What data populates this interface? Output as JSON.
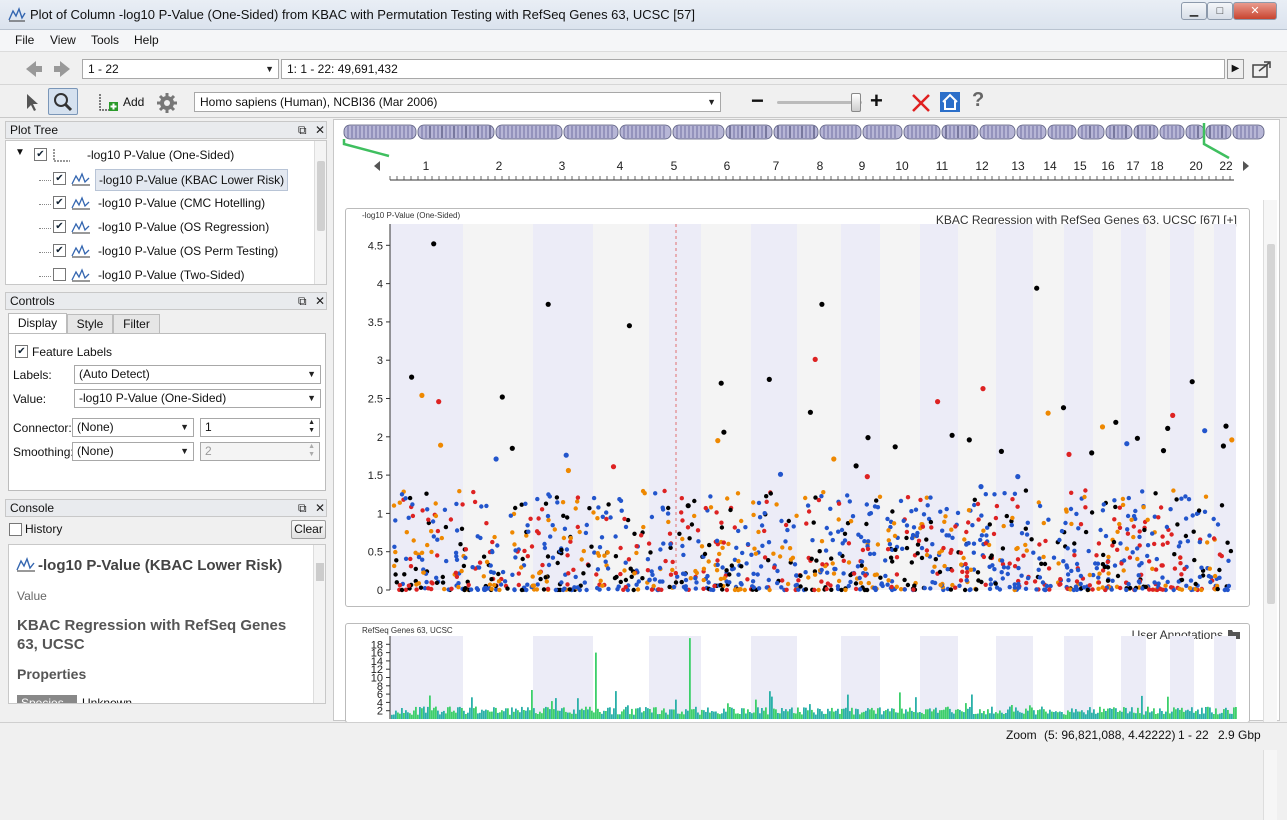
{
  "window": {
    "title": "Plot of Column -log10 P-Value (One-Sided) from KBAC with Permutation Testing with RefSeq Genes 63, UCSC [57]",
    "controls": {
      "minimize": "▁",
      "maximize": "□",
      "close": "✕"
    }
  },
  "menu": [
    "File",
    "View",
    "Tools",
    "Help"
  ],
  "nav": {
    "range": "1 - 22",
    "location": "1: 1 - 22: 49,691,432"
  },
  "toolbar": {
    "add_label": "Add",
    "genome": "Homo sapiens (Human), NCBI36 (Mar 2006)",
    "zoom_level": 0.95
  },
  "plot_tree": {
    "title": "Plot Tree",
    "items": [
      {
        "label": "-log10 P-Value (One-Sided)",
        "checked": true,
        "level": 0
      },
      {
        "label": "-log10 P-Value (KBAC Lower Risk)",
        "checked": true,
        "level": 1,
        "selected": true
      },
      {
        "label": "-log10 P-Value (CMC Hotelling)",
        "checked": true,
        "level": 1
      },
      {
        "label": "-log10 P-Value (OS Regression)",
        "checked": true,
        "level": 1
      },
      {
        "label": "-log10 P-Value (OS Perm Testing)",
        "checked": true,
        "level": 1
      },
      {
        "label": "-log10 P-Value (Two-Sided)",
        "checked": false,
        "level": 1
      }
    ]
  },
  "controls": {
    "title": "Controls",
    "tabs": [
      "Display",
      "Style",
      "Filter"
    ],
    "feature_labels": "Feature Labels",
    "labels_label": "Labels:",
    "labels_value": "(Auto Detect)",
    "value_label": "Value:",
    "value_value": "-log10 P-Value (One-Sided)",
    "connector_label": "Connector:",
    "connector_value": "(None)",
    "connector_num": "1",
    "smoothing_label": "Smoothing:",
    "smoothing_value": "(None)",
    "smoothing_num": "2"
  },
  "console": {
    "title": "Console",
    "history": "History",
    "clear": "Clear",
    "heading": "-log10 P-Value (KBAC Lower Risk)",
    "sub": "Value",
    "source": "KBAC Regression with RefSeq Genes 63, UCSC",
    "properties": "Properties",
    "prop_key": "Species",
    "prop_val": "Unknown"
  },
  "chromosomes": [
    "1",
    "2",
    "3",
    "4",
    "5",
    "6",
    "7",
    "8",
    "9",
    "10",
    "11",
    "12",
    "13",
    "14",
    "15",
    "16",
    "17",
    "18",
    "20",
    "22"
  ],
  "plot": {
    "ylabel": "-log10 P-Value (One-Sided)",
    "source_label": "KBAC Regression with RefSeq Genes 63, UCSC [67] [+]",
    "yticks": [
      "4.5",
      "4",
      "3.5",
      "3",
      "2.5",
      "2",
      "1.5",
      "1",
      "0.5",
      "0"
    ]
  },
  "annotations": {
    "ylabel": "RefSeq Genes 63, UCSC",
    "user_annotations": "User Annotations",
    "yticks": [
      "18",
      "16",
      "14",
      "12",
      "10",
      "8",
      "6",
      "4",
      "2"
    ]
  },
  "chart_data": {
    "type": "scatter",
    "title": "",
    "xlabel": "",
    "ylabel": "-log10 P-Value (One-Sided)",
    "ylim": [
      0,
      4.7
    ],
    "series": [
      {
        "color": "#000000",
        "x": [
          1,
          1,
          2,
          2,
          3,
          4,
          5,
          6,
          6,
          7,
          8,
          8,
          9,
          9,
          10,
          11,
          12,
          13,
          14,
          14,
          15,
          16,
          17,
          18,
          19,
          20,
          21,
          22
        ],
        "values": [
          2.78,
          4.52,
          2.52,
          1.85,
          3.73,
          3.45,
          1.1,
          2.06,
          2.7,
          2.75,
          3.73,
          2.32,
          1.62,
          1.99,
          1.87,
          2.02,
          1.96,
          1.81,
          3.94,
          2.38,
          1.79,
          2.19,
          1.98,
          1.82,
          2.11,
          2.72,
          2.14,
          1.88
        ]
      },
      {
        "color": "#ee8800",
        "x": [
          1,
          1,
          3,
          6,
          8,
          14,
          16,
          21
        ],
        "values": [
          2.54,
          1.89,
          1.56,
          1.95,
          1.71,
          2.31,
          2.13,
          1.96
        ]
      },
      {
        "color": "#dd2222",
        "x": [
          1,
          4,
          8,
          9,
          11,
          12,
          15,
          18
        ],
        "values": [
          2.46,
          1.61,
          3.01,
          1.48,
          2.46,
          2.63,
          1.77,
          2.28
        ]
      },
      {
        "color": "#2255cc",
        "x": [
          2,
          3,
          7,
          12,
          13,
          17,
          20
        ],
        "values": [
          1.71,
          1.76,
          1.51,
          1.35,
          1.48,
          1.91,
          2.08
        ]
      }
    ]
  },
  "status": {
    "zoom_label": "Zoom",
    "coords": "(5: 96,821,088, 4.42222)",
    "range": "1 - 22",
    "size": "2.9 Gbp"
  }
}
